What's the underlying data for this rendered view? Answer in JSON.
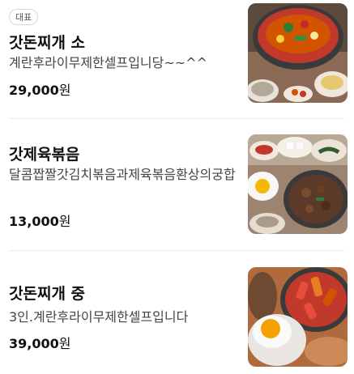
{
  "menu": {
    "items": [
      {
        "badge": "대표",
        "name": "갓돈찌개 소",
        "description": "계란후라이무제한셀프입니당~~^^",
        "price": "29,000",
        "currency": "원",
        "image_icon": "stew-photo"
      },
      {
        "name": "갓제육볶음",
        "description": "달콤짭짤갓김치볶음과제육볶음환상의궁합",
        "price": "13,000",
        "currency": "원",
        "image_icon": "stirfry-photo"
      },
      {
        "name": "갓돈찌개 중",
        "description": "3인.계란후라이무제한셀프입니다",
        "price": "39,000",
        "currency": "원",
        "image_icon": "stew-egg-photo"
      }
    ]
  }
}
